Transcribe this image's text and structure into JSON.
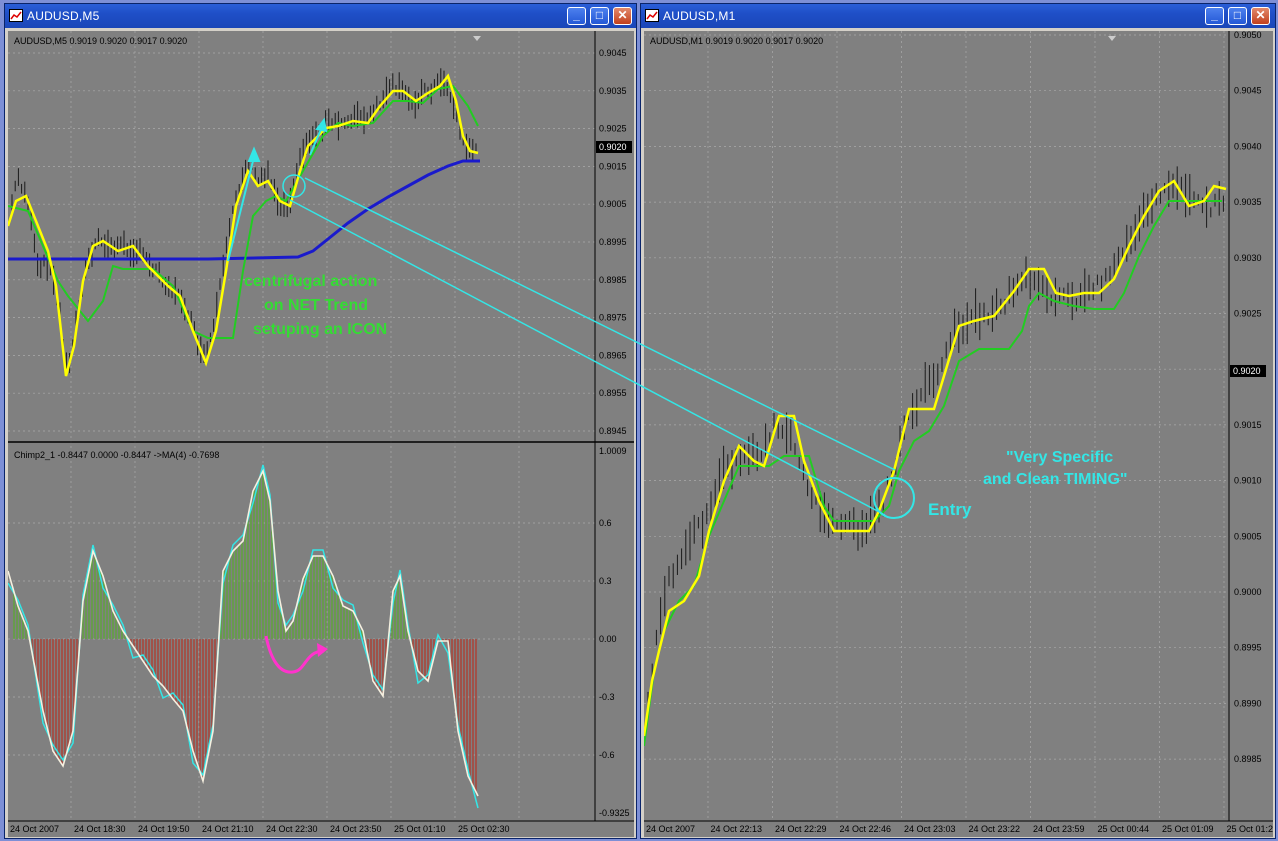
{
  "windows": [
    {
      "title": "AUDUSD,M5",
      "info": "AUDUSD,M5  0.9019 0.9020 0.9017 0.9020",
      "price_axis": [
        "0.9045",
        "0.9035",
        "0.9025",
        "0.9015",
        "0.9005",
        "0.8995",
        "0.8985",
        "0.8975",
        "0.8965",
        "0.8955",
        "0.8945"
      ],
      "current_price": "0.9020",
      "indicator_info": "Chimp2_1 -0.8447 0.0000 -0.8447  ->MA(4) -0.7698",
      "indicator_axis": [
        "1.0009",
        "0.6",
        "0.3",
        "0.00",
        "-0.3",
        "-0.6",
        "-0.9325"
      ],
      "time_axis": [
        "24 Oct 2007",
        "24 Oct 18:30",
        "24 Oct 19:50",
        "24 Oct 21:10",
        "24 Oct 22:30",
        "24 Oct 23:50",
        "25 Oct 01:10",
        "25 Oct 02:30"
      ],
      "annotation": [
        "centrifugal action",
        "on NET Trend",
        "setuping an ICON"
      ]
    },
    {
      "title": "AUDUSD,M1",
      "info": "AUDUSD,M1  0.9019 0.9020 0.9017 0.9020",
      "price_axis": [
        "0.9050",
        "0.9045",
        "0.9040",
        "0.9035",
        "0.9030",
        "0.9025",
        "0.9020",
        "0.9015",
        "0.9010",
        "0.9005",
        "0.9000",
        "0.8995",
        "0.8990",
        "0.8985"
      ],
      "current_price": "0.9020",
      "time_axis": [
        "24 Oct 2007",
        "24 Oct 22:13",
        "24 Oct 22:29",
        "24 Oct 22:46",
        "24 Oct 23:03",
        "24 Oct 23:22",
        "24 Oct 23:59",
        "25 Oct 00:44",
        "25 Oct 01:09",
        "25 Oct 01:2"
      ],
      "annotation_quote": [
        "\"Very Specific",
        "and Clean TIMING\""
      ],
      "entry_label": "Entry"
    }
  ],
  "window_buttons": {
    "minimize": "_",
    "maximize": "□",
    "close": "✕"
  },
  "colors": {
    "chart_bg": "#808080",
    "price_bar": "#1a1a1a",
    "fast_ma": "#ffff00",
    "slow_ma": "#22cc22",
    "trend_ma": "#1a1acc",
    "annotation_arrow": "#33e6e6",
    "annotation_text_green": "#33dd33",
    "annotation_text_cyan": "#33e6e6",
    "magenta_arrow": "#ff33cc",
    "histogram_pos": "#5aa832",
    "histogram_neg": "#b03a2e"
  }
}
